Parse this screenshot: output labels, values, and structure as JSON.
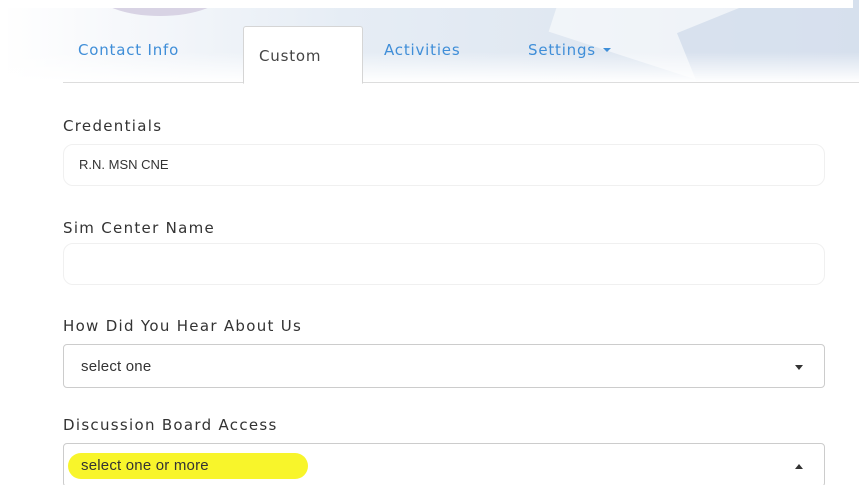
{
  "colors": {
    "tab_link": "#3f8ed8",
    "highlight": "#f8f52b",
    "text": "#333333"
  },
  "tabs": [
    {
      "label": "Contact Info",
      "active": false
    },
    {
      "label": "Custom",
      "active": true
    },
    {
      "label": "Activities",
      "active": false
    },
    {
      "label": "Settings",
      "active": false,
      "icon": "caret-down-icon"
    }
  ],
  "form": {
    "credentials": {
      "label": "Credentials",
      "value": "R.N. MSN CNE"
    },
    "sim_center_name": {
      "label": "Sim Center Name",
      "value": ""
    },
    "how_did_you_hear": {
      "label": "How Did You Hear About Us",
      "value": "select one",
      "icon": "chevron-down-icon"
    },
    "discussion_board_access": {
      "label": "Discussion Board Access",
      "value": "select one or more",
      "icon": "chevron-up-icon",
      "expanded": true
    }
  }
}
